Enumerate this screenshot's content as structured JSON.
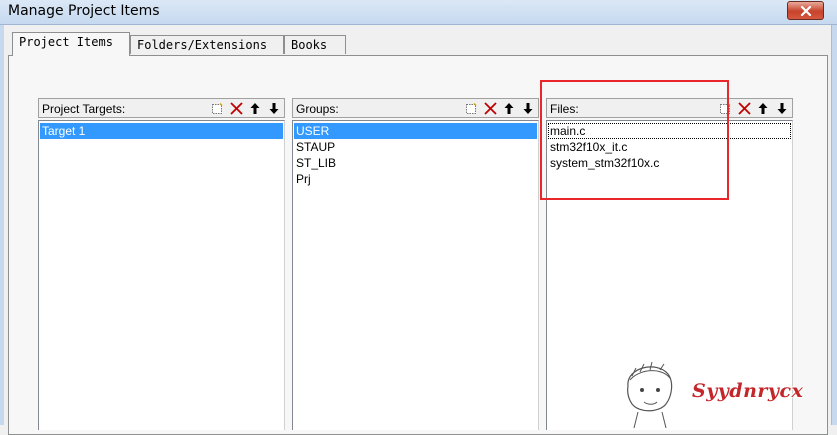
{
  "window": {
    "title": "Manage Project Items",
    "close_icon": "close-icon"
  },
  "tabs": [
    {
      "label": "Project Items",
      "active": true
    },
    {
      "label": "Folders/Extensions",
      "active": false
    },
    {
      "label": "Books",
      "active": false
    }
  ],
  "targets": {
    "title": "Project Targets:",
    "items": [
      "Target 1"
    ],
    "selected": "Target 1",
    "tools": [
      "new-icon",
      "delete-icon",
      "move-up-icon",
      "move-down-icon"
    ]
  },
  "groups": {
    "title": "Groups:",
    "items": [
      "USER",
      "STAUP",
      "ST_LIB",
      "Prj"
    ],
    "selected": "USER",
    "tools": [
      "new-icon",
      "delete-icon",
      "move-up-icon",
      "move-down-icon"
    ]
  },
  "files": {
    "title": "Files:",
    "items": [
      "main.c",
      "stm32f10x_it.c",
      "system_stm32f10x.c"
    ],
    "focused": "main.c",
    "tools": [
      "new-icon",
      "delete-icon",
      "move-up-icon",
      "move-down-icon"
    ]
  },
  "annotation": {
    "color": "#e8262b"
  },
  "watermark": {
    "text": "Syydnrycx"
  },
  "colors": {
    "selection": "#3399ff",
    "close_button": "#c7432b"
  }
}
